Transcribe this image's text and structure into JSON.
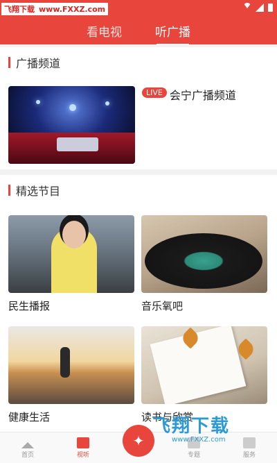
{
  "status_bar": {
    "watermark_name": "飞翔下载",
    "watermark_url": "www.FXXZ.com"
  },
  "top_tabs": [
    {
      "label": "看电视",
      "active": false
    },
    {
      "label": "听广播",
      "active": true
    }
  ],
  "broadcast_section": {
    "title": "广播频道",
    "channel": {
      "badge": "LIVE",
      "name": "会宁广播频道"
    }
  },
  "featured_section": {
    "title": "精选节目",
    "programs": [
      {
        "label": "民生播报",
        "thumb": "news-anchor"
      },
      {
        "label": "音乐氧吧",
        "thumb": "vinyl-record"
      },
      {
        "label": "健康生活",
        "thumb": "runner-sunset"
      },
      {
        "label": "读书与欣赏",
        "thumb": "open-book"
      }
    ]
  },
  "bottom_nav": [
    {
      "label": "首页",
      "icon": "home-icon",
      "active": false
    },
    {
      "label": "视听",
      "icon": "tv-icon",
      "active": true
    },
    {
      "label": "",
      "icon": "center-logo-icon",
      "active": false
    },
    {
      "label": "专题",
      "icon": "topic-icon",
      "active": false
    },
    {
      "label": "服务",
      "icon": "service-icon",
      "active": false
    }
  ],
  "watermark_bottom": {
    "title": "飞翔下载",
    "url": "www.FXXZ.com"
  },
  "colors": {
    "accent": "#e8463c",
    "watermark_blue": "#2a9ad8"
  }
}
